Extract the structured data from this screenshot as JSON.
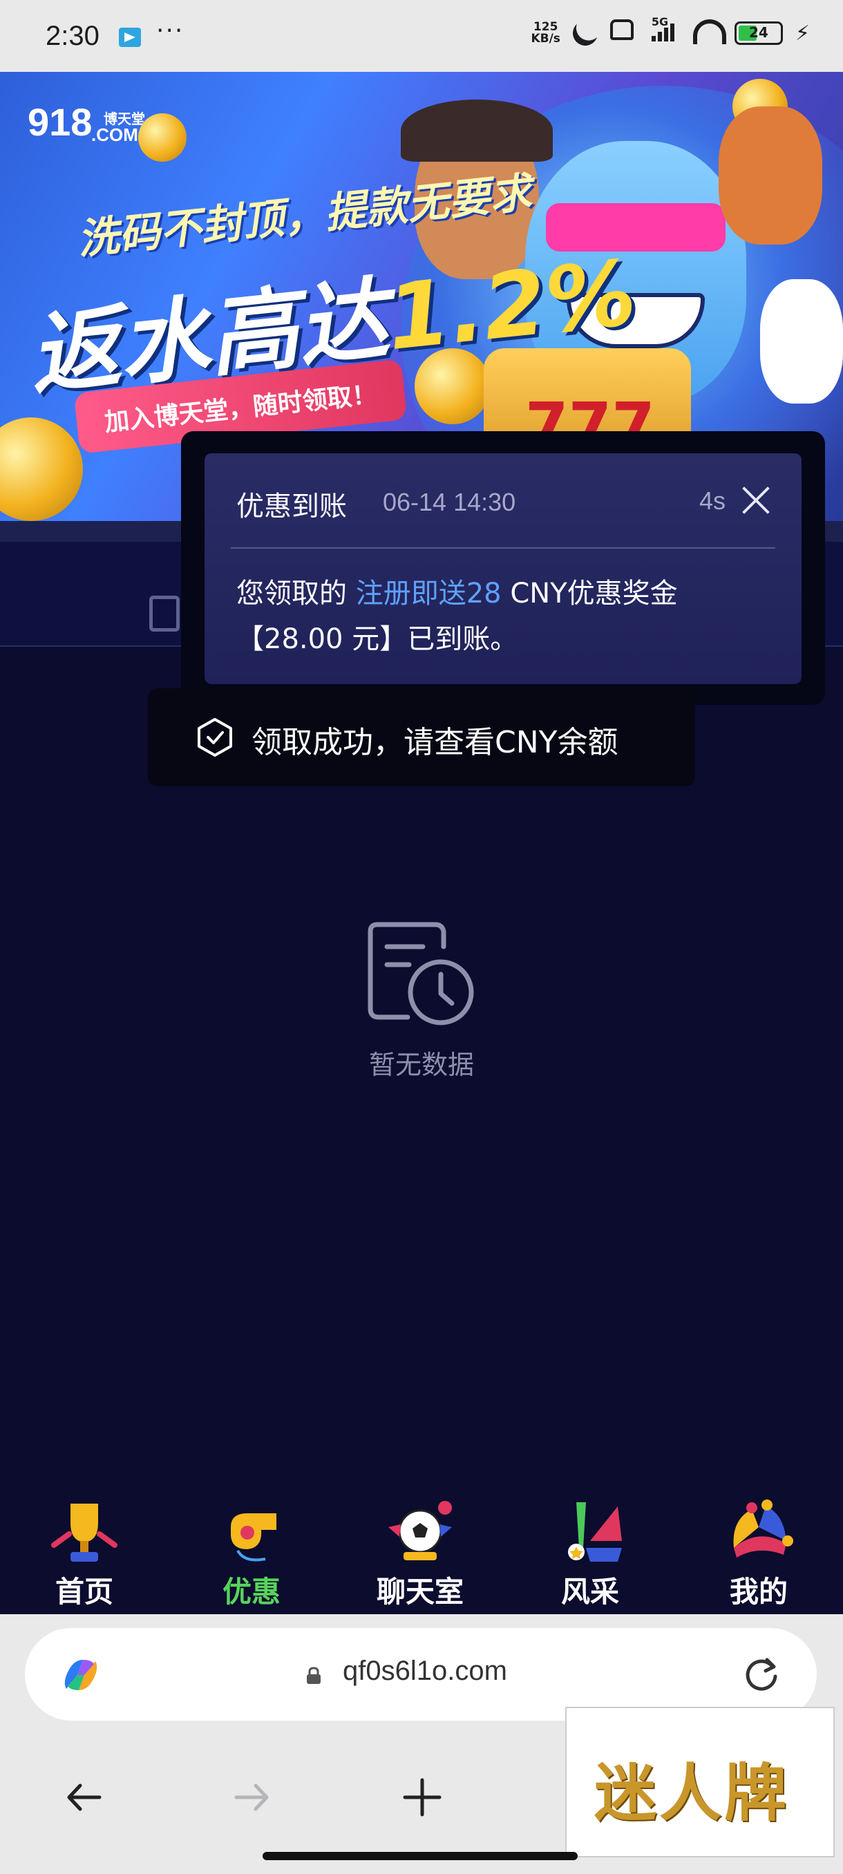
{
  "status_bar": {
    "time": "2:30",
    "more": "···",
    "net_speed_value": "125",
    "net_speed_unit": "KB/s",
    "signal_label": "5G",
    "battery": "24"
  },
  "banner": {
    "logo": "918",
    "logo_sub": "博天堂",
    "logo_com": ".COM",
    "line1": "洗码不封顶，提款无要求",
    "line2_prefix": "返水高达",
    "line2_highlight": "1.2%",
    "pill": "加入博天堂，随时领取！"
  },
  "notification": {
    "title": "优惠到账",
    "time": "06-14 14:30",
    "countdown": "4s",
    "body_prefix": "您领取的 ",
    "body_link": "注册即送28",
    "body_suffix": " CNY优惠奖金【28.00 元】已到账。"
  },
  "toast": {
    "text": "领取成功，请查看CNY余额"
  },
  "empty_state": {
    "text": "暂无数据"
  },
  "bottom_nav": {
    "items": [
      {
        "label": "首页"
      },
      {
        "label": "优惠"
      },
      {
        "label": "聊天室"
      },
      {
        "label": "风采"
      },
      {
        "label": "我的"
      }
    ],
    "active_color": "#58d35a"
  },
  "browser": {
    "url": "qf0s6l1o.com"
  },
  "watermark": {
    "text": "迷人牌"
  }
}
